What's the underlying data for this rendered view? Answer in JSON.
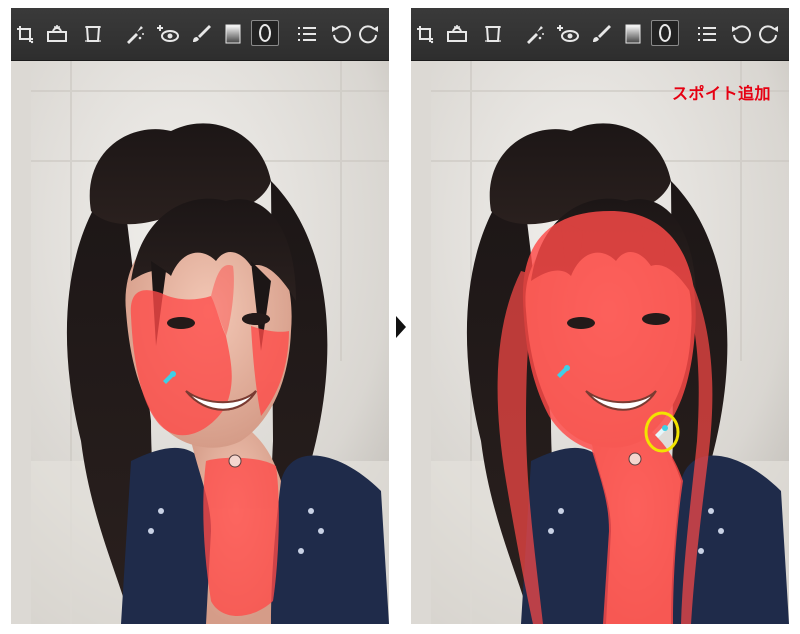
{
  "toolbar": {
    "tools": [
      {
        "name": "crop-tool-icon"
      },
      {
        "name": "spot-removal-icon"
      },
      {
        "name": "transform-icon"
      },
      {
        "name": "dropper-brush-icon"
      },
      {
        "name": "red-eye-add-icon"
      },
      {
        "name": "brush-icon"
      },
      {
        "name": "graduated-filter-icon"
      },
      {
        "name": "radial-filter-icon"
      },
      {
        "name": "list-icon"
      },
      {
        "name": "undo-icon"
      },
      {
        "name": "redo-icon"
      }
    ]
  },
  "annotation": {
    "text": "スポイト追加",
    "color": "#e60012"
  },
  "colors": {
    "mask_overlay": "#ff4a48",
    "dropper_marker": "#3fd0e6",
    "highlight_circle": "#f2e400",
    "toolbar_bg": "#333333",
    "icon_color": "#e8e8e8"
  }
}
